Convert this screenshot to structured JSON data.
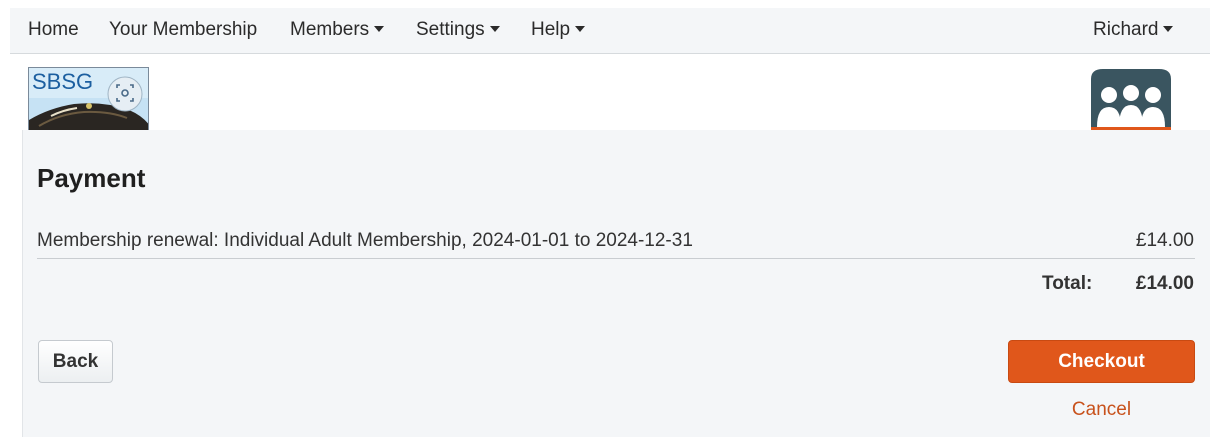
{
  "nav": {
    "home": "Home",
    "membership": "Your Membership",
    "members": "Members",
    "settings": "Settings",
    "help": "Help",
    "user": "Richard"
  },
  "logo": {
    "left_text": "SBSG"
  },
  "payment": {
    "title": "Payment",
    "line_description": "Membership renewal: Individual Adult Membership, 2024-01-01 to 2024-12-31",
    "line_amount": "£14.00",
    "total_label": "Total:",
    "total_value": "£14.00"
  },
  "actions": {
    "back": "Back",
    "checkout": "Checkout",
    "cancel": "Cancel"
  },
  "colors": {
    "accent": "#e0571b",
    "link": "#c8521c",
    "panel": "#f4f6f8"
  },
  "icons": [
    "caret-down-icon",
    "focus-icon",
    "members-group-icon"
  ]
}
